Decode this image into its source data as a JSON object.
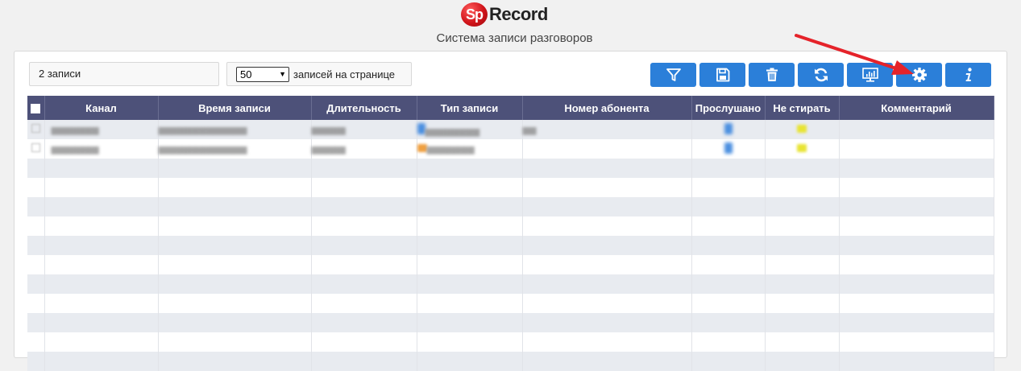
{
  "header": {
    "logo_badge": "Sp",
    "logo_text": "Record",
    "subtitle": "Система записи разговоров"
  },
  "controls": {
    "records_count": "2 записи",
    "per_page_value": "50",
    "per_page_label": "записей на странице"
  },
  "toolbar": [
    {
      "name": "filter-button",
      "icon": "filter-icon"
    },
    {
      "name": "save-button",
      "icon": "floppy-icon"
    },
    {
      "name": "delete-button",
      "icon": "trash-icon"
    },
    {
      "name": "refresh-button",
      "icon": "refresh-icon"
    },
    {
      "name": "monitor-button",
      "icon": "monitor-icon"
    },
    {
      "name": "settings-button",
      "icon": "gear-icon"
    },
    {
      "name": "info-button",
      "icon": "info-icon"
    }
  ],
  "table": {
    "columns": [
      "Канал",
      "Время записи",
      "Длительность",
      "Тип записи",
      "Номер абонента",
      "Прослушано",
      "Не стирать",
      "Комментарий"
    ]
  },
  "colors": {
    "accent": "#2b7fd9",
    "table_header": "#4d5179",
    "arrow": "#e5232a"
  }
}
